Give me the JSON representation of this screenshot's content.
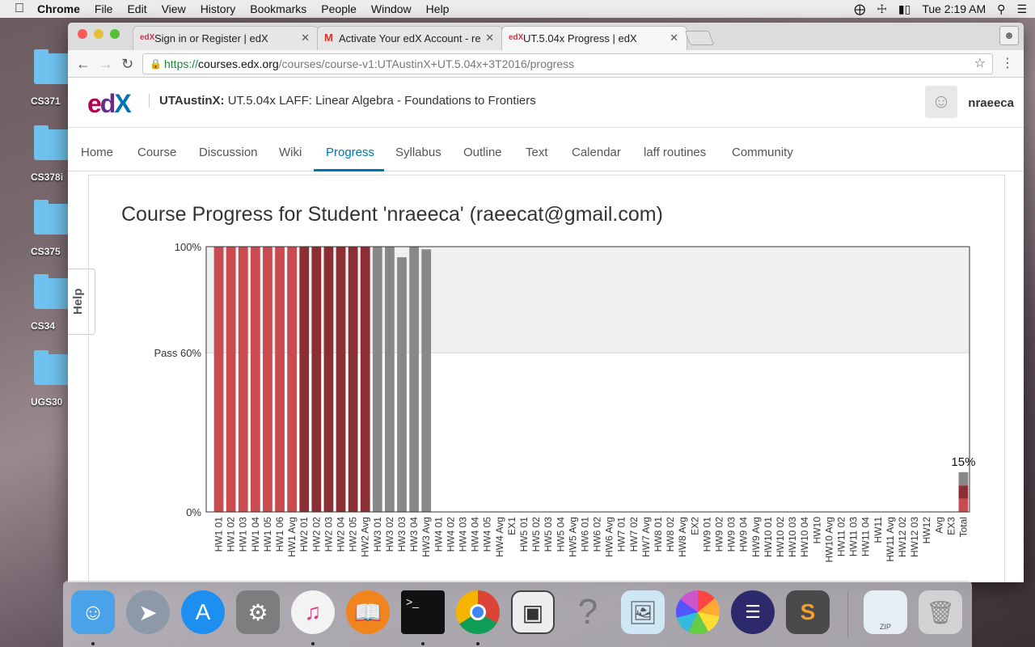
{
  "menubar": {
    "app_name": "Chrome",
    "menus": [
      "File",
      "Edit",
      "View",
      "History",
      "Bookmarks",
      "People",
      "Window",
      "Help"
    ],
    "clock": "Tue 2:19 AM"
  },
  "desktop": {
    "folders": [
      "CS371",
      "CS378i",
      "CS375",
      "CS34",
      "UGS30"
    ]
  },
  "browser": {
    "tabs": [
      {
        "title": "Sign in or Register | edX",
        "favicon": "edX"
      },
      {
        "title": "Activate Your edX Account - re",
        "favicon": "M"
      },
      {
        "title": "UT.5.04x Progress | edX",
        "favicon": "edX"
      }
    ],
    "url": {
      "scheme": "https://",
      "host": "courses.edx.org",
      "path": "/courses/course-v1:UTAustinX+UT.5.04x+3T2016/progress"
    }
  },
  "header": {
    "logo": "edX",
    "org": "UTAustinX:",
    "course": "UT.5.04x LAFF: Linear Algebra - Foundations to Frontiers",
    "username": "nraeeca"
  },
  "course_nav": [
    "Home",
    "Course",
    "Discussion",
    "Wiki",
    "Progress",
    "Syllabus",
    "Outline",
    "Text",
    "Calendar",
    "laff routines",
    "Community"
  ],
  "help_tab": "Help",
  "progress_title": "Course Progress for Student 'nraeeca' (raeecat@gmail.com)",
  "colors": {
    "hw1": "#c94b4f",
    "hw2": "#8c2f34",
    "hw3": "#888888",
    "edx_blue": "#0075b4"
  },
  "chart_data": {
    "type": "bar",
    "ylim": [
      0,
      100
    ],
    "yticks": [
      "100%",
      "Pass 60%",
      "0%"
    ],
    "pass_threshold": 60,
    "categories": [
      "HW1 01",
      "HW1 02",
      "HW1 03",
      "HW1 04",
      "HW1 05",
      "HW1 06",
      "HW1 Avg",
      "HW2 01",
      "HW2 02",
      "HW2 03",
      "HW2 04",
      "HW2 05",
      "HW2 Avg",
      "HW3 01",
      "HW3 02",
      "HW3 03",
      "HW3 04",
      "HW3 Avg",
      "HW4 01",
      "HW4 02",
      "HW4 03",
      "HW4 04",
      "HW4 05",
      "HW4 Avg",
      "EX1",
      "HW5 01",
      "HW5 02",
      "HW5 03",
      "HW5 04",
      "HW5 Avg",
      "HW6 01",
      "HW6 02",
      "HW6 Avg",
      "HW7 01",
      "HW7 02",
      "HW7 Avg",
      "HW8 01",
      "HW8 02",
      "HW8 Avg",
      "EX2",
      "HW9 01",
      "HW9 02",
      "HW9 03",
      "HW9 04",
      "HW9 Avg",
      "HW10 01",
      "HW10 02",
      "HW10 03",
      "HW10 04",
      "HW10",
      "HW10 Avg",
      "HW11 02",
      "HW11 03",
      "HW11 04",
      "HW11",
      "HW11 Avg",
      "HW12 02",
      "HW12 03",
      "HW12",
      "Avg",
      "EX3",
      "Total"
    ],
    "values": [
      100,
      100,
      100,
      100,
      100,
      100,
      100,
      100,
      100,
      100,
      100,
      100,
      100,
      100,
      100,
      96,
      100,
      99,
      0,
      0,
      0,
      0,
      0,
      0,
      0,
      0,
      0,
      0,
      0,
      0,
      0,
      0,
      0,
      0,
      0,
      0,
      0,
      0,
      0,
      0,
      0,
      0,
      0,
      0,
      0,
      0,
      0,
      0,
      0,
      0,
      0,
      0,
      0,
      0,
      0,
      0,
      0,
      0,
      0,
      0,
      0,
      0
    ],
    "groups": [
      "hw1",
      "hw1",
      "hw1",
      "hw1",
      "hw1",
      "hw1",
      "hw1",
      "hw2",
      "hw2",
      "hw2",
      "hw2",
      "hw2",
      "hw2",
      "hw3",
      "hw3",
      "hw3",
      "hw3",
      "hw3",
      "none",
      "none",
      "none",
      "none",
      "none",
      "none",
      "none",
      "none",
      "none",
      "none",
      "none",
      "none",
      "none",
      "none",
      "none",
      "none",
      "none",
      "none",
      "none",
      "none",
      "none",
      "none",
      "none",
      "none",
      "none",
      "none",
      "none",
      "none",
      "none",
      "none",
      "none",
      "none",
      "none",
      "none",
      "none",
      "none",
      "none",
      "none",
      "none",
      "none",
      "none",
      "none",
      "none",
      "total"
    ],
    "total_stack": [
      {
        "group": "hw1",
        "value": 5
      },
      {
        "group": "hw2",
        "value": 5
      },
      {
        "group": "hw3",
        "value": 5
      }
    ],
    "total_label": "15%"
  },
  "dock": {
    "apps": [
      "Finder",
      "Launchpad",
      "App Store",
      "System Preferences",
      "iTunes",
      "iBooks",
      "Terminal",
      "Chrome",
      "Disk Utility",
      "Help",
      "Preview",
      "Photos",
      "Eclipse",
      "Sublime Text",
      "Archive",
      "Trash"
    ],
    "archive_label": "ZIP"
  }
}
